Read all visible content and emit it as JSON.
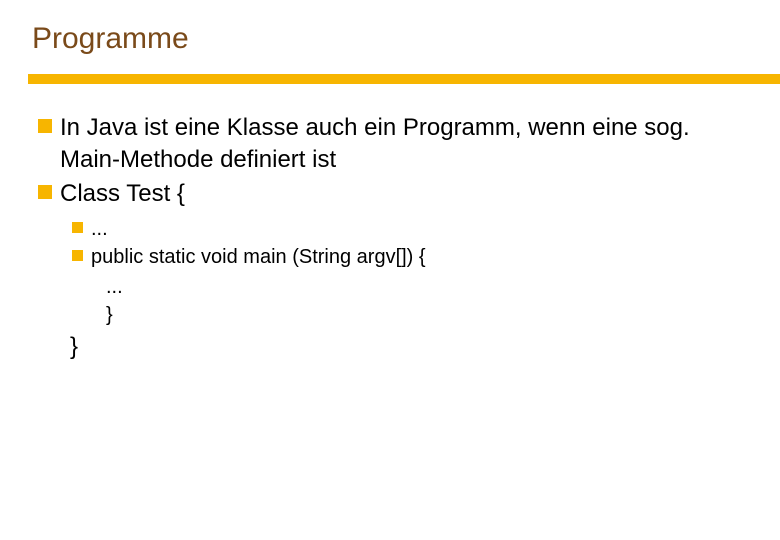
{
  "slide": {
    "title": "Programme",
    "bullets": [
      {
        "text": "In Java ist eine Klasse auch ein Programm, wenn eine sog. Main-Methode definiert ist"
      },
      {
        "text": "Class Test {",
        "sub": [
          {
            "text": "..."
          },
          {
            "text": "public static void main (String argv[]) {"
          }
        ],
        "inner": [
          "...",
          "}"
        ],
        "close": "}"
      }
    ]
  }
}
